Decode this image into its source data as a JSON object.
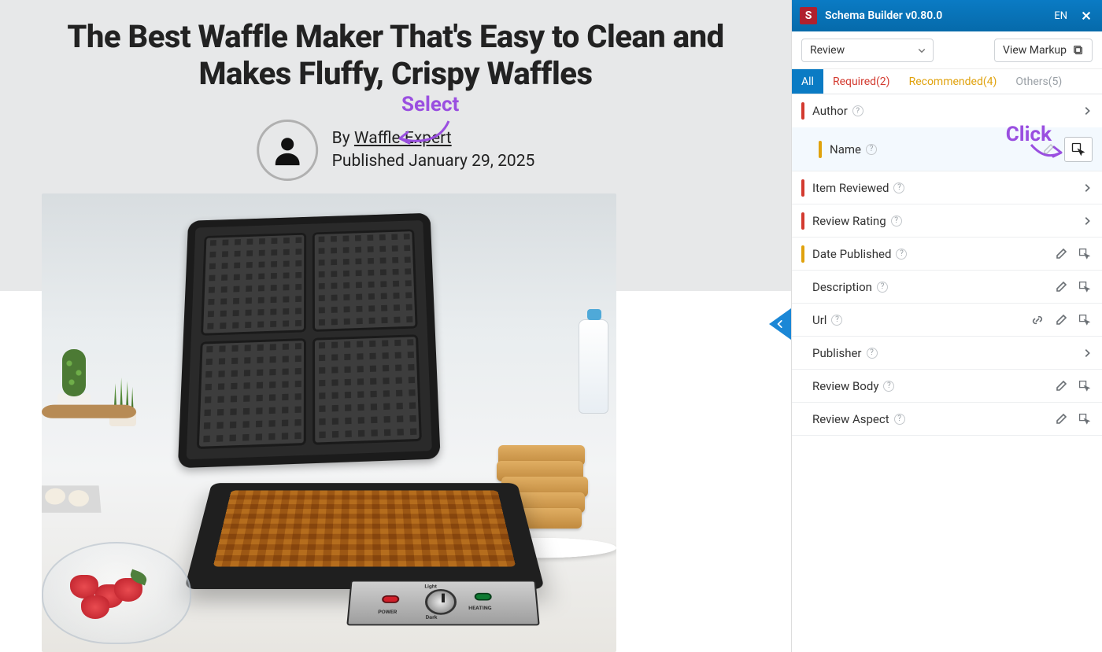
{
  "article": {
    "headline": "The Best Waffle Maker That's Easy to Clean and Makes Fluffy, Crispy Waffles",
    "byline_prefix": "By ",
    "author_name": "Waffle Expert",
    "published_prefix": "Published ",
    "published_date": "January 29, 2025"
  },
  "annotations": {
    "select_label": "Select",
    "click_label": "Click"
  },
  "panel": {
    "title": "Schema Builder v0.80.0",
    "lang": "EN",
    "type_select": "Review",
    "view_markup": "View Markup",
    "tabs": {
      "all": "All",
      "required": "Required(2)",
      "recommended": "Recommended(4)",
      "others": "Others(5)"
    },
    "properties": {
      "author": "Author",
      "author_name": "Name",
      "item_reviewed": "Item Reviewed",
      "review_rating": "Review Rating",
      "date_published": "Date Published",
      "description": "Description",
      "url": "Url",
      "publisher": "Publisher",
      "review_body": "Review Body",
      "review_aspect": "Review Aspect"
    }
  },
  "appliance_panel": {
    "power": "POWER",
    "light": "Light",
    "dark": "Dark",
    "heating": "HEATING"
  }
}
